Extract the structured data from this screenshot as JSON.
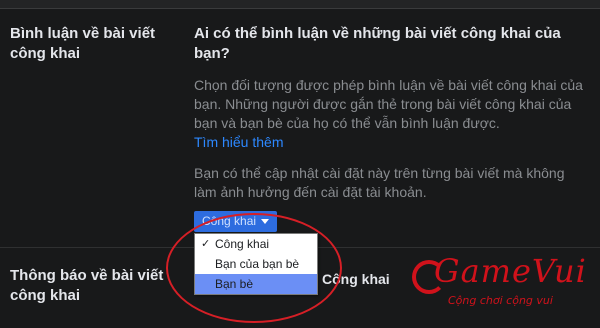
{
  "section1": {
    "title": "Bình luận về bài viết công khai",
    "question": "Ai có thể bình luận về những bài viết công khai của bạn?",
    "description": "Chọn đối tượng được phép bình luận về bài viết công khai của bạn. Những người được gắn thẻ trong bài viết công khai của bạn và bạn bè của họ có thể vẫn bình luận được.",
    "learn_more": "Tìm hiểu thêm",
    "note": "Bạn có thể cập nhật cài đặt này trên từng bài viết mà không làm ảnh hưởng đến cài đặt tài khoản.",
    "dropdown_label": "Công khai"
  },
  "menu": {
    "items": [
      {
        "label": "Công khai",
        "checked": "✓"
      },
      {
        "label": "Bạn của bạn bè",
        "checked": ""
      },
      {
        "label": "Bạn bè",
        "checked": ""
      }
    ]
  },
  "section2": {
    "title": "Thông báo về bài viết công khai",
    "value": "Công khai"
  },
  "watermark": {
    "brand": "GameVui",
    "tagline": "Cộng chơi cộng vui"
  },
  "colors": {
    "background": "#18191a",
    "accent": "#2d6cdf",
    "link": "#2d88ff",
    "highlight": "#6b8ff5",
    "annotation": "#d61f26"
  }
}
